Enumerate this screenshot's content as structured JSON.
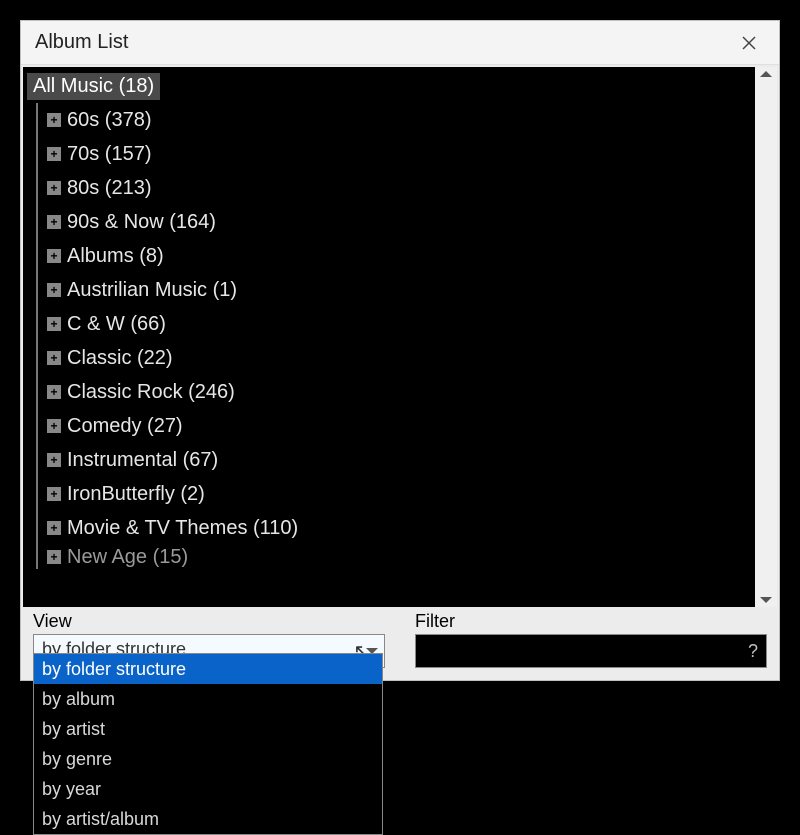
{
  "window": {
    "title": "Album List"
  },
  "tree": {
    "root": {
      "label": "All Music (18)"
    },
    "items": [
      {
        "label": "60s (378)"
      },
      {
        "label": "70s (157)"
      },
      {
        "label": "80s (213)"
      },
      {
        "label": "90s & Now (164)"
      },
      {
        "label": "Albums (8)"
      },
      {
        "label": "Austrilian Music (1)"
      },
      {
        "label": "C & W (66)"
      },
      {
        "label": "Classic (22)"
      },
      {
        "label": "Classic Rock (246)"
      },
      {
        "label": "Comedy (27)"
      },
      {
        "label": "Instrumental (67)"
      },
      {
        "label": "IronButterfly (2)"
      },
      {
        "label": "Movie & TV Themes (110)"
      },
      {
        "label": "New Age (15)"
      }
    ]
  },
  "controls": {
    "view_label": "View",
    "filter_label": "Filter",
    "view_selected": "by folder structure",
    "filter_value": "",
    "filter_help": "?"
  },
  "dropdown": {
    "options": [
      "by folder structure",
      "by album",
      "by artist",
      "by genre",
      "by year",
      "by artist/album"
    ],
    "selected_index": 0
  }
}
